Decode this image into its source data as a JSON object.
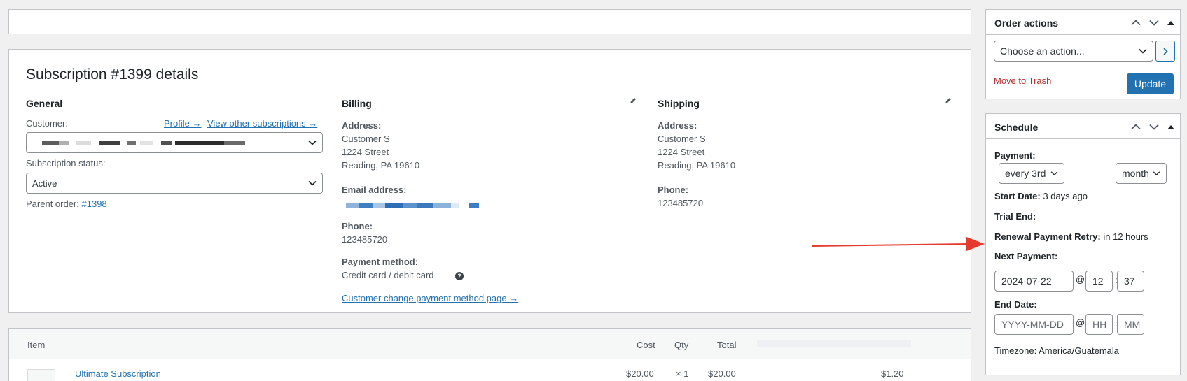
{
  "subscription": {
    "title": "Subscription #1399 details",
    "general": {
      "heading": "General",
      "customer_label": "Customer:",
      "profile_link": "Profile →",
      "other_subs_link": "View other subscriptions →",
      "status_label": "Subscription status:",
      "status_value": "Active",
      "parent_label": "Parent order:",
      "parent_link": "#1398"
    },
    "billing": {
      "heading": "Billing",
      "address_label": "Address:",
      "address_lines": [
        "Customer S",
        "1224 Street",
        "Reading, PA 19610"
      ],
      "email_label": "Email address:",
      "phone_label": "Phone:",
      "phone_value": "123485720",
      "payment_label": "Payment method:",
      "payment_value": "Credit card / debit card",
      "change_link": "Customer change payment method page →"
    },
    "shipping": {
      "heading": "Shipping",
      "address_label": "Address:",
      "address_lines": [
        "Customer S",
        "1224 Street",
        "Reading, PA 19610"
      ],
      "phone_label": "Phone:",
      "phone_value": "123485720"
    }
  },
  "items": {
    "headers": {
      "item": "Item",
      "cost": "Cost",
      "qty": "Qty",
      "total": "Total"
    },
    "rows": [
      {
        "name": "Ultimate Subscription",
        "cost": "$20.00",
        "qty": "× 1",
        "total": "$20.00",
        "tax": "$1.20"
      }
    ]
  },
  "order_actions": {
    "title": "Order actions",
    "select_value": "Choose an action...",
    "trash_link": "Move to Trash",
    "update_label": "Update"
  },
  "schedule": {
    "title": "Schedule",
    "payment_label": "Payment:",
    "interval_value": "every 3rd",
    "period_value": "month",
    "start_label": "Start Date:",
    "start_value": "3 days ago",
    "trial_label": "Trial End:",
    "trial_value": "-",
    "retry_label": "Renewal Payment Retry:",
    "retry_value": "in 12 hours",
    "next_label": "Next Payment:",
    "next_date": "2024-07-22",
    "at": "@",
    "colon": ":",
    "next_hour": "12",
    "next_minute": "37",
    "end_label": "End Date:",
    "end_date_placeholder": "YYYY-MM-DD",
    "end_hour_placeholder": "HH",
    "end_minute_placeholder": "MM",
    "timezone_label": "Timezone:",
    "timezone_value": "America/Guatemala"
  },
  "colors": {
    "accent": "#2271b1",
    "danger": "#b32d2e",
    "arrow": "#e53b2f"
  }
}
